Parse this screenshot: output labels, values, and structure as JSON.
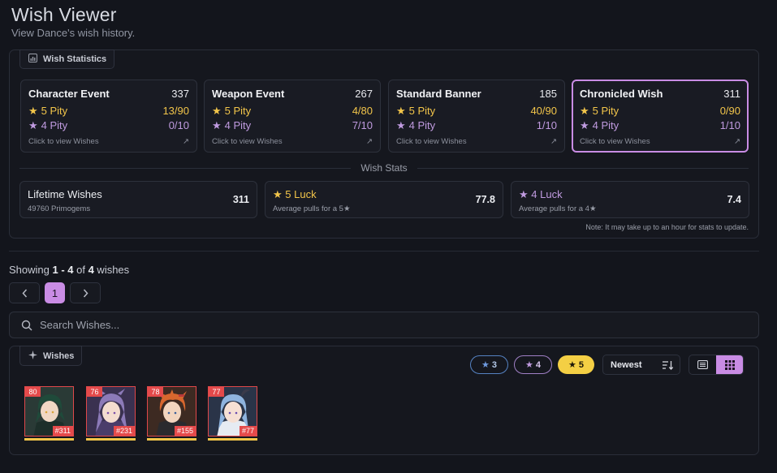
{
  "header": {
    "title": "Wish Viewer",
    "subtitle": "View Dance's wish history."
  },
  "stats": {
    "legend": "Wish Statistics",
    "banners": [
      {
        "name": "Character Event",
        "count": "337",
        "five_label": "5 Pity",
        "five_value": "13/90",
        "four_label": "4 Pity",
        "four_value": "0/10",
        "link": "Click to view Wishes",
        "active": false
      },
      {
        "name": "Weapon Event",
        "count": "267",
        "five_label": "5 Pity",
        "five_value": "4/80",
        "four_label": "4 Pity",
        "four_value": "7/10",
        "link": "Click to view Wishes",
        "active": false
      },
      {
        "name": "Standard Banner",
        "count": "185",
        "five_label": "5 Pity",
        "five_value": "40/90",
        "four_label": "4 Pity",
        "four_value": "1/10",
        "link": "Click to view Wishes",
        "active": false
      },
      {
        "name": "Chronicled Wish",
        "count": "311",
        "five_label": "5 Pity",
        "five_value": "0/90",
        "four_label": "4 Pity",
        "four_value": "1/10",
        "link": "Click to view Wishes",
        "active": true
      }
    ],
    "divider_label": "Wish Stats",
    "lifetime": {
      "title": "Lifetime Wishes",
      "sub": "49760 Primogems",
      "value": "311"
    },
    "luck5": {
      "title": "5 Luck",
      "sub": "Average pulls for a 5★",
      "value": "77.8"
    },
    "luck4": {
      "title": "4 Luck",
      "sub": "Average pulls for a 4★",
      "value": "7.4"
    },
    "note": "Note: It may take up to an hour for stats to update."
  },
  "pagination": {
    "showing_prefix": "Showing ",
    "showing_range": "1 - 4",
    "showing_mid": " of ",
    "showing_total": "4",
    "showing_suffix": " wishes",
    "current_page": "1",
    "prev_icon": "chevron-left-icon",
    "next_icon": "chevron-right-icon"
  },
  "search": {
    "placeholder": "Search Wishes..."
  },
  "wishes": {
    "legend": "Wishes",
    "filters": [
      {
        "label": "3",
        "color": "#6f9be0"
      },
      {
        "label": "4",
        "color": "#c09be0"
      },
      {
        "label": "5",
        "color": "#f4cf44"
      }
    ],
    "sort_label": "Newest",
    "items": [
      {
        "pity": "80",
        "number": "#311",
        "character": "green-haired-character"
      },
      {
        "pity": "76",
        "number": "#231",
        "character": "purple-haired-character"
      },
      {
        "pity": "78",
        "number": "#155",
        "character": "orange-haired-character"
      },
      {
        "pity": "77",
        "number": "#77",
        "character": "blue-haired-character"
      }
    ]
  },
  "colors": {
    "accent": "#c98ce4",
    "gold": "#f2c54a",
    "purple": "#c09be0",
    "pity_badge": "#e44a4b",
    "background": "#13151c"
  }
}
